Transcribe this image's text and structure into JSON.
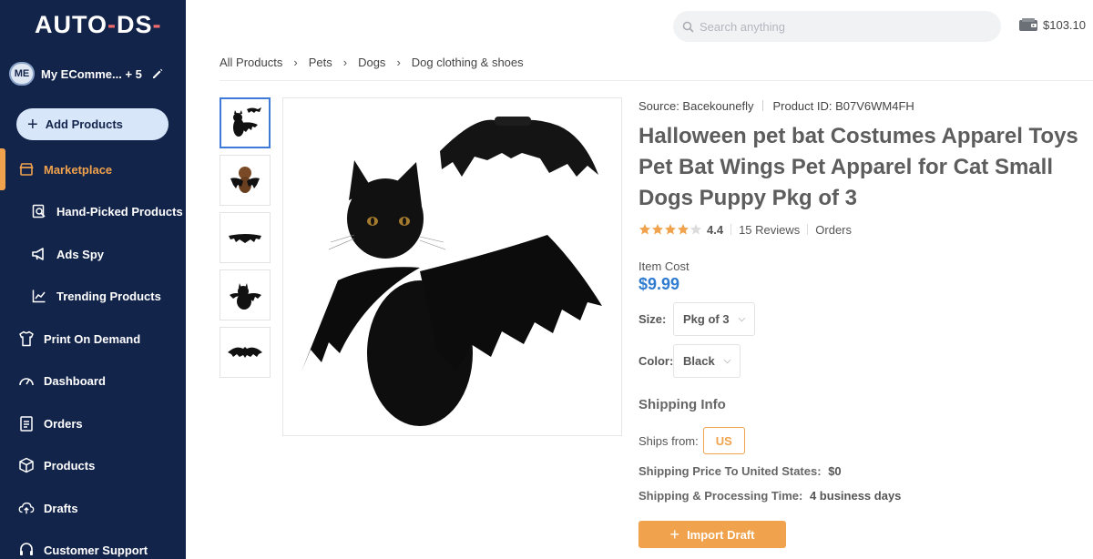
{
  "sidebar": {
    "logo_text": "AUTO-DS-",
    "account": {
      "initials": "ME",
      "name": "My EComme... + 5"
    },
    "add_products_label": "Add Products",
    "items": [
      {
        "label": "Marketplace",
        "icon": "store-icon"
      },
      {
        "label": "Hand-Picked Products",
        "icon": "search-doc-icon"
      },
      {
        "label": "Ads Spy",
        "icon": "megaphone-icon"
      },
      {
        "label": "Trending Products",
        "icon": "trend-chart-icon"
      },
      {
        "label": "Print On Demand",
        "icon": "shirt-icon"
      },
      {
        "label": "Dashboard",
        "icon": "gauge-icon"
      },
      {
        "label": "Orders",
        "icon": "clipboard-icon"
      },
      {
        "label": "Products",
        "icon": "box-icon"
      },
      {
        "label": "Drafts",
        "icon": "cloud-upload-icon"
      },
      {
        "label": "Customer Support",
        "icon": "headset-icon"
      }
    ],
    "active_item": "Marketplace"
  },
  "header": {
    "search_placeholder": "Search anything",
    "balance": "$103.10"
  },
  "breadcrumb": [
    "All Products",
    "Pets",
    "Dogs",
    "Dog clothing & shoes"
  ],
  "product": {
    "source": "Source: Bacekounefly",
    "product_id": "Product ID: B07V6WM4FH",
    "title": "Halloween pet bat Costumes Apparel Toys Pet Bat Wings Pet Apparel for Cat Small Dogs Puppy Pkg of 3",
    "rating": "4.4",
    "rating_value": 4.4,
    "reviews": "15 Reviews",
    "orders_label": "Orders",
    "item_cost_label": "Item Cost",
    "price": "$9.99",
    "size_label": "Size:",
    "size_value": "Pkg of 3",
    "color_label": "Color:",
    "color_value": "Black"
  },
  "shipping": {
    "title": "Shipping Info",
    "ships_from_label": "Ships from:",
    "ships_from_value": "US",
    "price_label": "Shipping Price To United States:",
    "price_value": "$0",
    "time_label": "Shipping & Processing Time:",
    "time_value": "4 business days"
  },
  "import_label": "Import Draft",
  "colors": {
    "sidebar_bg": "#13244b",
    "accent": "#f0a24c",
    "price": "#2f7bd0",
    "thumb_selected": "#3e7bd8"
  }
}
